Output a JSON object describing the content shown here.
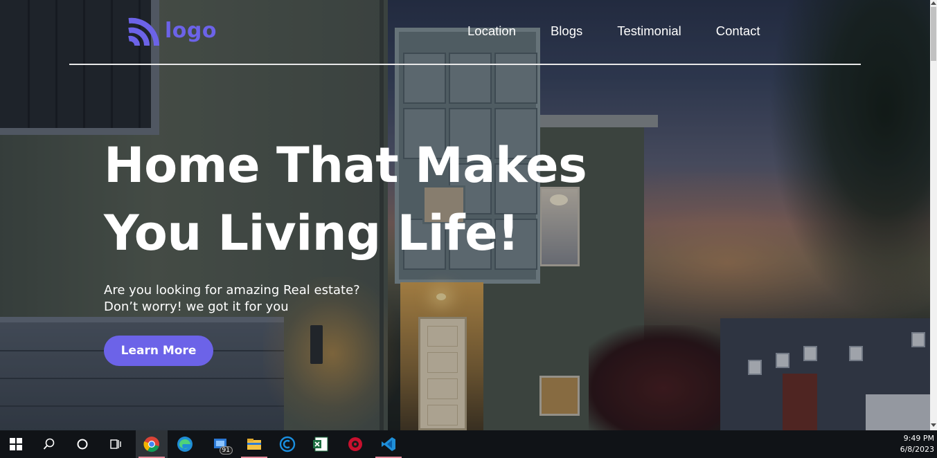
{
  "brand": {
    "logo_text": "logo",
    "accent": "#6c63e8"
  },
  "nav": {
    "items": [
      {
        "label": "Location"
      },
      {
        "label": "Blogs"
      },
      {
        "label": "Testimonial"
      },
      {
        "label": "Contact"
      }
    ]
  },
  "hero": {
    "headline_line1": "Home That Makes",
    "headline_line2": "You Living Life!",
    "subtext": "Are you looking for amazing Real estate? Don’t worry! we got it for you",
    "cta_label": "Learn More"
  },
  "taskbar": {
    "icons": [
      "windows-start-icon",
      "search-icon",
      "cortana-icon",
      "task-view-icon",
      "chrome-icon",
      "edge-icon",
      "mail-icon",
      "file-explorer-icon",
      "ccleaner-icon",
      "excel-icon",
      "app-red-icon",
      "vscode-icon"
    ],
    "mail_badge": "91",
    "time": "9:49 PM",
    "date": "6/8/2023"
  }
}
